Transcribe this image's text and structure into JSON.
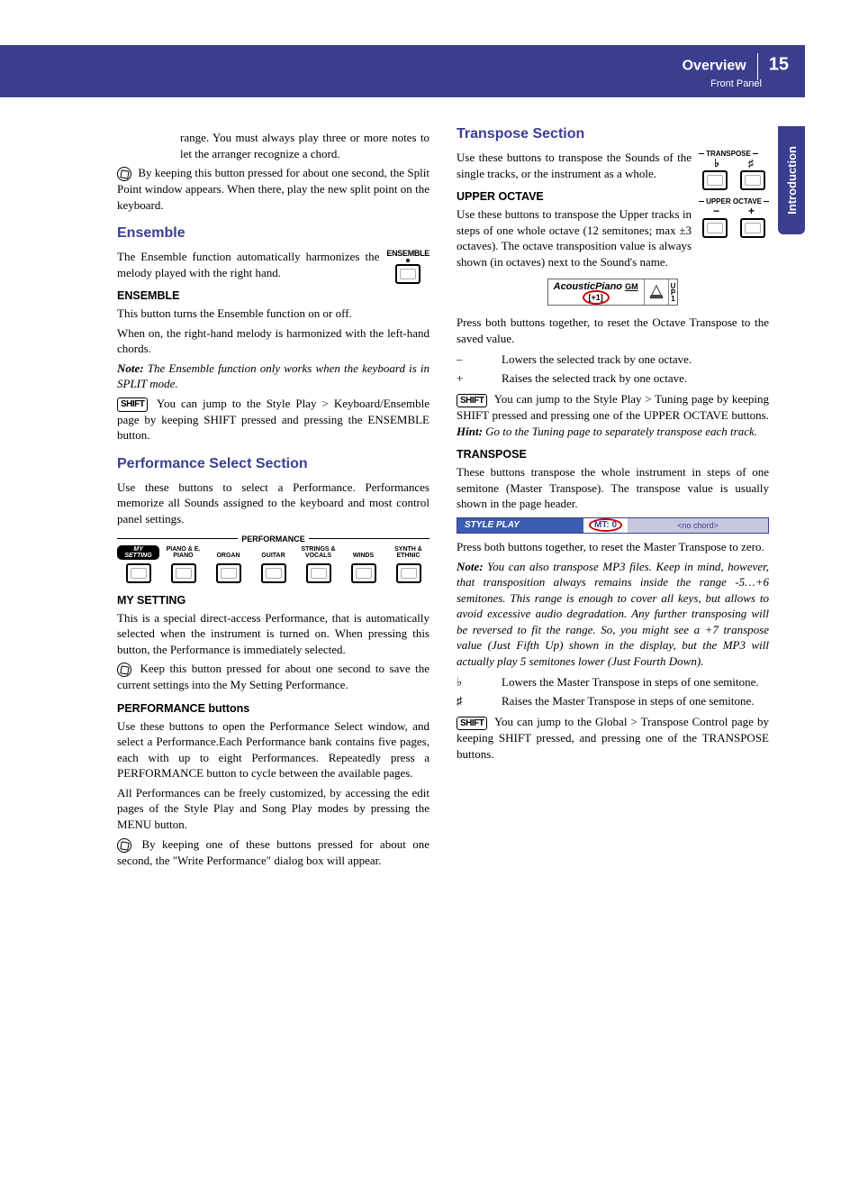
{
  "header": {
    "title": "Overview",
    "subtitle": "Front Panel",
    "page": "15"
  },
  "side_tab": "Introduction",
  "left": {
    "intro_p1": "range. You must always play three or more notes to let the arranger recognize a chord.",
    "hold_p1": "By keeping this button pressed for about one second, the Split Point window appears. When there, play the new split point on the keyboard.",
    "ensemble": {
      "title": "Ensemble",
      "panel_label": "ENSEMBLE",
      "intro": "The Ensemble function automatically harmonizes the melody played with the right hand.",
      "sub_title": "ENSEMBLE",
      "p1": "This button turns the Ensemble function on or off.",
      "p2": "When on, the right-hand melody is harmonized with the left-hand chords.",
      "note_label": "Note:",
      "note": "The Ensemble function only works when the keyboard is in SPLIT mode.",
      "shift_label": "SHIFT",
      "shift_text": "You can jump to the Style Play > Keyboard/Ensemble page by keeping SHIFT pressed and pressing the ENSEMBLE button."
    },
    "perf": {
      "title": "Performance Select Section",
      "intro": "Use these buttons to select a Performance. Performances memorize all Sounds assigned to the keyboard and most control panel settings.",
      "panel_header": "PERFORMANCE",
      "my_setting_pill": "MY SETTING",
      "labels": [
        "PIANO & E. PIANO",
        "ORGAN",
        "GUITAR",
        "STRINGS & VOCALS",
        "WINDS",
        "SYNTH & ETHNIC"
      ],
      "mysetting_title": "MY SETTING",
      "mysetting_p1": "This is a special direct-access Performance, that is automatically selected when the instrument is turned on. When pressing this button, the Performance is immediately selected.",
      "mysetting_hold": "Keep this button pressed for about one second to save the current settings into the My Setting Performance.",
      "buttons_title": "PERFORMANCE buttons",
      "buttons_p1": "Use these buttons to open the Performance Select window, and select a Performance.Each Performance bank contains five pages, each with up to eight Performances. Repeatedly press a PERFORMANCE button to cycle between the available pages.",
      "buttons_p2": "All Performances can be freely customized, by accessing the edit pages of the Style Play and Song Play modes by pressing the MENU button.",
      "buttons_hold": "By keeping one of these buttons pressed for about one second, the \"Write Performance\" dialog box will appear."
    }
  },
  "right": {
    "transpose": {
      "title": "Transpose Section",
      "intro": "Use these buttons to transpose the Sounds of the single tracks, or the instrument as a whole.",
      "panel_tp": "TRANSPOSE",
      "panel_uo": "UPPER OCTAVE",
      "flat": "♭",
      "sharp": "♯",
      "minus": "−",
      "plus": "+",
      "uo_title": "UPPER OCTAVE",
      "uo_p1": "Use these buttons to transpose the Upper tracks in steps of one whole octave (12 semitones; max ±3 octaves). The octave transposition value is always shown (in octaves) next to the Sound's name.",
      "ab_name": "AcousticPiano",
      "ab_gm": "GM",
      "ab_val": "[+1]",
      "ab_up1": [
        "U",
        "P",
        "1"
      ],
      "uo_p2": "Press both buttons together, to reset the Octave Transpose to the saved value.",
      "row_minus_key": "–",
      "row_minus_val": "Lowers the selected track by one octave.",
      "row_plus_key": "+",
      "row_plus_val": "Raises the selected track by one octave.",
      "shift_label": "SHIFT",
      "uo_shift": "You can jump to the Style Play > Tuning page by keeping SHIFT pressed and pressing one of the UPPER OCTAVE buttons. ",
      "hint_label": "Hint:",
      "hint": "Go to the Tuning page to separately transpose each track.",
      "tp_title": "TRANSPOSE",
      "tp_p1": "These buttons transpose the whole instrument in steps of one semitone (Master Transpose). The transpose value is usually shown in the page header.",
      "sp_left": "STYLE PLAY",
      "sp_mt": "MT: 0",
      "sp_right": "<no chord>",
      "tp_p2": "Press both buttons together, to reset the Master Transpose to zero.",
      "note_label": "Note:",
      "tp_note": "You can also transpose MP3 files. Keep in mind, however, that transposition always remains inside the range -5…+6 semitones. This range is enough to cover all keys, but allows to avoid excessive audio degradation. Any further transposing will be reversed to fit the range. So, you might see a +7 transpose value (Just Fifth Up) shown in the display, but the MP3 will actually play 5 semitones lower (Just Fourth Down).",
      "row_flat_key": "♭",
      "row_flat_val": "Lowers the Master Transpose in steps of one semitone.",
      "row_sharp_key": "♯",
      "row_sharp_val": "Raises the Master Transpose in steps of one semitone.",
      "tp_shift": "You can jump to the Global > Transpose Control page by keeping SHIFT pressed, and pressing one of the TRANSPOSE buttons."
    }
  }
}
